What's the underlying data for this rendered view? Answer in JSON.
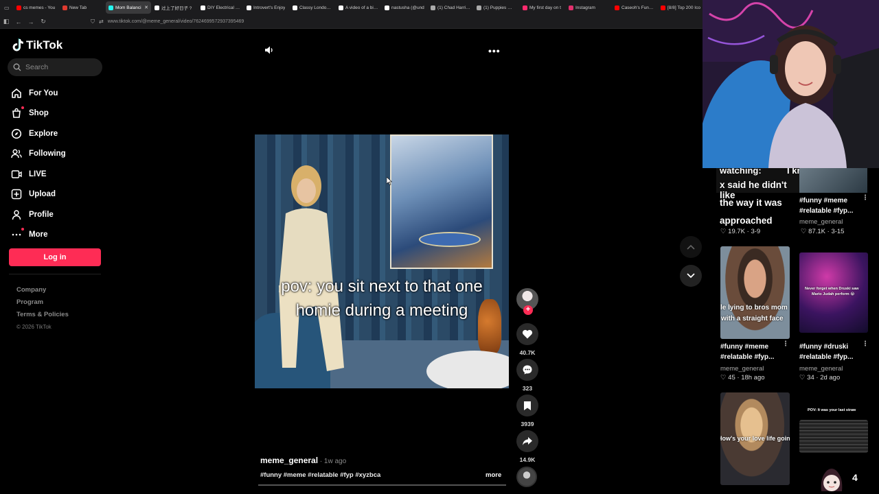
{
  "browser": {
    "tabs": [
      {
        "title": "cs memes - You",
        "color": "#ff0000"
      },
      {
        "title": "New Tab",
        "color": "#e03a2f"
      },
      {
        "title": "Mom Balanci",
        "color": "#25f4ee",
        "active": true
      },
      {
        "title": "过上了好日子 ?",
        "color": "#ffffff"
      },
      {
        "title": "DIY Electrical Cri",
        "color": "#ffffff"
      },
      {
        "title": "Introvert's Enjoy",
        "color": "#ffffff"
      },
      {
        "title": "Classy London N",
        "color": "#ffffff"
      },
      {
        "title": "A video of a bizar",
        "color": "#ffffff"
      },
      {
        "title": "nastusha (@und",
        "color": "#ffffff"
      },
      {
        "title": "(1) Chad Harrisor",
        "color": "#aaaaaa"
      },
      {
        "title": "(1) Puppies 🐶 c",
        "color": "#aaaaaa"
      },
      {
        "title": "My first day on t",
        "color": "#ff2a6d"
      },
      {
        "title": "Instagram",
        "color": "#e1306c"
      },
      {
        "title": "Caseoh's Funnie",
        "color": "#ff0000"
      },
      {
        "title": "[8/8] Top 200 Ico",
        "color": "#ff0000"
      }
    ],
    "url": "www.tiktok.com/@meme_general/video/7624699572937395469"
  },
  "sidebar": {
    "brand": "TikTok",
    "search_placeholder": "Search",
    "items": [
      {
        "label": "For You",
        "icon": "home-icon"
      },
      {
        "label": "Shop",
        "icon": "shop-icon",
        "dot": true
      },
      {
        "label": "Explore",
        "icon": "compass-icon"
      },
      {
        "label": "Following",
        "icon": "following-icon"
      },
      {
        "label": "LIVE",
        "icon": "live-icon"
      },
      {
        "label": "Upload",
        "icon": "upload-icon"
      },
      {
        "label": "Profile",
        "icon": "profile-icon"
      },
      {
        "label": "More",
        "icon": "more-icon",
        "dot": true
      }
    ],
    "login_label": "Log in",
    "footer": [
      "Company",
      "Program",
      "Terms & Policies"
    ],
    "copyright": "© 2026 TikTok"
  },
  "video": {
    "caption_line1": "pov: you sit next to that one",
    "caption_line2": "homie during a meeting",
    "author": "meme_general",
    "posted": " · 1w ago",
    "hashtags": "#funny #meme #relatable #fyp #xyzbca",
    "more_label": "more",
    "progress": 0.0
  },
  "actions": {
    "likes": "40.7K",
    "comments": "323",
    "saves": "3939",
    "shares": "14.9K"
  },
  "related": [
    {
      "overlay": [
        "x said he didn't like",
        "the way it was",
        "approached"
      ],
      "tags": "#funny #meme #relatable #fyp...",
      "author": "",
      "likes": "19.7K",
      "date": "3-9"
    },
    {
      "overlay": [],
      "tags": "#funny #meme #relatable #fyp...",
      "author": "meme_general",
      "likes": "87.1K",
      "date": "3-15"
    },
    {
      "overlay": [
        "le lying to bros mom",
        "with a straight face"
      ],
      "tags": "#funny #meme #relatable #fyp...",
      "author": "meme_general",
      "likes": "45",
      "date": "18h ago"
    },
    {
      "overlay": [
        "Never forget when Druski saw",
        "Mario Judah perform 😭"
      ],
      "tags": "#funny #druski #relatable #fyp...",
      "author": "meme_general",
      "likes": "34",
      "date": "2d ago"
    },
    {
      "overlay": [
        "How's your love life going?"
      ],
      "tags": "",
      "author": "",
      "likes": "",
      "date": ""
    },
    {
      "overlay": [
        "POV: It was your last straw"
      ],
      "tags": "",
      "author": "",
      "likes": "",
      "date": ""
    }
  ],
  "right_panel": {
    "top_overlay": "watching:",
    "top_overlay_right": "I know",
    "count": "4"
  },
  "colors": {
    "accent": "#fe2c55",
    "background": "#000000",
    "muted": "#8a8a8a"
  }
}
